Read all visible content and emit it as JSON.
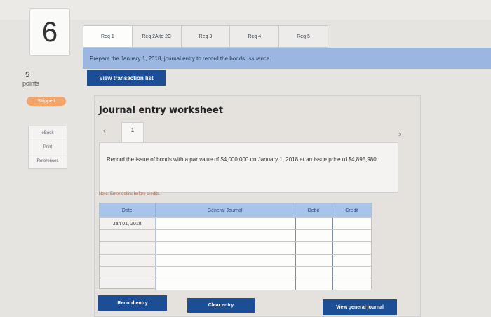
{
  "question": {
    "number": "6",
    "points_value": "5",
    "points_label": "points",
    "status": "Skipped"
  },
  "side_links": [
    "eBook",
    "Print",
    "References"
  ],
  "tabs": [
    {
      "label": "Req 1",
      "active": true
    },
    {
      "label": "Req 2A to 2C",
      "active": false
    },
    {
      "label": "Req 3",
      "active": false
    },
    {
      "label": "Req 4",
      "active": false
    },
    {
      "label": "Req 5",
      "active": false
    }
  ],
  "prompt": "Prepare the January 1, 2018, journal entry to record the bonds' issuance.",
  "view_transaction_list": "View transaction list",
  "worksheet": {
    "title": "Journal entry worksheet",
    "entry_tab": "1",
    "description": "Record the issue of bonds with a par value of $4,000,000 on January 1, 2018 at an issue price of $4,895,980.",
    "note": "Note: Enter debits before credits.",
    "table": {
      "headers": {
        "date": "Date",
        "account": "General Journal",
        "debit": "Debit",
        "credit": "Credit"
      },
      "rows": [
        {
          "date": "Jan 01, 2018"
        },
        {
          "date": ""
        },
        {
          "date": ""
        },
        {
          "date": ""
        },
        {
          "date": ""
        },
        {
          "date": ""
        }
      ]
    },
    "buttons": {
      "record": "Record entry",
      "clear": "Clear entry",
      "view_journal": "View general journal"
    }
  },
  "icons": {
    "nav_prev": "chevron-left-icon",
    "nav_next": "chevron-right-icon"
  },
  "colors": {
    "primary_button": "#1c4e96",
    "header_blue": "#a8c4e8",
    "prompt_bar": "#9bb6e0",
    "skipped_badge": "#f1a56b"
  }
}
